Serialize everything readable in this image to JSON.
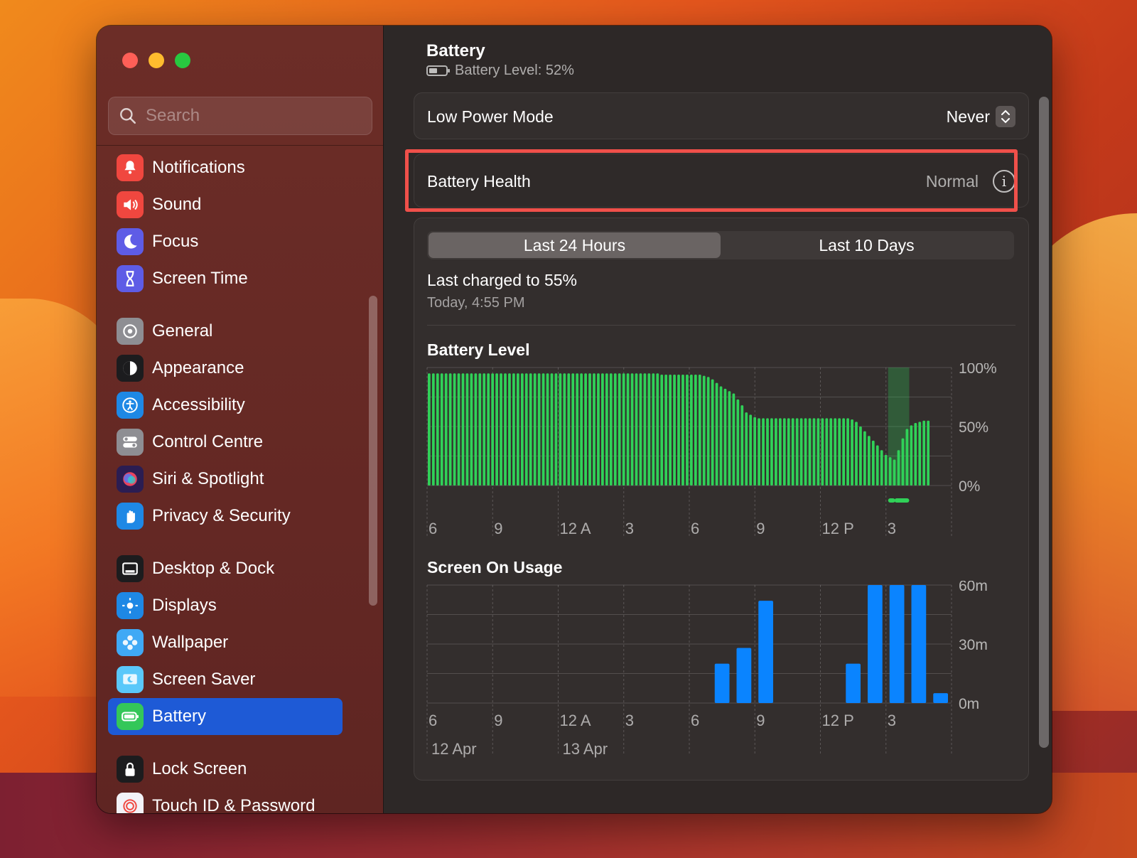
{
  "window": {
    "title": "Battery"
  },
  "search": {
    "placeholder": "Search"
  },
  "sidebar": {
    "groups": [
      [
        {
          "label": "Notifications",
          "icon": "bell-icon",
          "color": "#f0473f"
        },
        {
          "label": "Sound",
          "icon": "speaker-icon",
          "color": "#f0473f"
        },
        {
          "label": "Focus",
          "icon": "moon-icon",
          "color": "#5e5ce6"
        },
        {
          "label": "Screen Time",
          "icon": "hourglass-icon",
          "color": "#5e5ce6"
        }
      ],
      [
        {
          "label": "General",
          "icon": "gear-icon",
          "color": "#8e8e93"
        },
        {
          "label": "Appearance",
          "icon": "appearance-icon",
          "color": "#1c1c1e"
        },
        {
          "label": "Accessibility",
          "icon": "accessibility-icon",
          "color": "#1e88e5"
        },
        {
          "label": "Control Centre",
          "icon": "toggles-icon",
          "color": "#8e8e93"
        },
        {
          "label": "Siri & Spotlight",
          "icon": "siri-icon",
          "color": "#2b1d52"
        },
        {
          "label": "Privacy & Security",
          "icon": "hand-icon",
          "color": "#1e88e5"
        }
      ],
      [
        {
          "label": "Desktop & Dock",
          "icon": "dock-icon",
          "color": "#1c1c1e"
        },
        {
          "label": "Displays",
          "icon": "sun-icon",
          "color": "#1e88e5"
        },
        {
          "label": "Wallpaper",
          "icon": "flower-icon",
          "color": "#3fa9f5"
        },
        {
          "label": "Screen Saver",
          "icon": "screensaver-icon",
          "color": "#5ac8fa"
        },
        {
          "label": "Battery",
          "icon": "battery-icon",
          "color": "#34c759",
          "active": true
        }
      ],
      [
        {
          "label": "Lock Screen",
          "icon": "lock-icon",
          "color": "#1c1c1e"
        },
        {
          "label": "Touch ID & Password",
          "icon": "fingerprint-icon",
          "color": "#f2f2f7"
        }
      ]
    ]
  },
  "header": {
    "title": "Battery",
    "level_text": "Battery Level: 52%"
  },
  "low_power": {
    "label": "Low Power Mode",
    "value": "Never"
  },
  "health": {
    "label": "Battery Health",
    "value": "Normal"
  },
  "tabs": [
    {
      "label": "Last 24 Hours",
      "selected": true
    },
    {
      "label": "Last 10 Days",
      "selected": false
    }
  ],
  "last_charged": {
    "text": "Last charged to 55%",
    "time": "Today, 4:55 PM"
  },
  "colors": {
    "battery_green": "#30d158",
    "usage_blue": "#0a84ff",
    "highlight_red": "#f0504a"
  },
  "chart_data": [
    {
      "type": "bar",
      "title": "Battery Level",
      "ytick_labels": [
        "100%",
        "50%",
        "0%"
      ],
      "ylim": [
        0,
        100
      ],
      "xtick_labels": [
        "6",
        "9",
        "12 A",
        "3",
        "6",
        "9",
        "12 P",
        "3"
      ],
      "values": [
        95,
        95,
        95,
        95,
        95,
        95,
        95,
        95,
        95,
        95,
        95,
        95,
        95,
        95,
        95,
        95,
        95,
        95,
        95,
        95,
        95,
        95,
        95,
        95,
        95,
        95,
        95,
        95,
        95,
        95,
        95,
        95,
        95,
        95,
        95,
        95,
        95,
        95,
        95,
        95,
        95,
        95,
        95,
        95,
        95,
        95,
        95,
        95,
        95,
        95,
        95,
        95,
        95,
        95,
        95,
        94,
        94,
        94,
        94,
        94,
        94,
        94,
        94,
        94,
        94,
        93,
        92,
        90,
        87,
        84,
        82,
        80,
        78,
        73,
        68,
        62,
        60,
        58,
        57,
        57,
        57,
        57,
        57,
        57,
        57,
        57,
        57,
        57,
        57,
        57,
        57,
        57,
        57,
        57,
        57,
        57,
        57,
        57,
        57,
        57,
        56,
        54,
        50,
        46,
        42,
        38,
        34,
        30,
        26,
        24,
        22,
        30,
        40,
        48,
        51,
        53,
        54,
        55,
        55
      ],
      "charging_window": [
        109,
        114
      ]
    },
    {
      "type": "bar",
      "title": "Screen On Usage",
      "ytick_labels": [
        "60m",
        "30m",
        "0m"
      ],
      "ylim": [
        0,
        60
      ],
      "xtick_labels": [
        "6",
        "9",
        "12 A",
        "3",
        "6",
        "9",
        "12 P",
        "3"
      ],
      "date_labels": [
        "12 Apr",
        "13 Apr"
      ],
      "values": [
        0,
        0,
        0,
        0,
        0,
        0,
        0,
        0,
        0,
        0,
        0,
        0,
        0,
        20,
        28,
        52,
        0,
        0,
        0,
        20,
        60,
        60,
        60,
        5
      ]
    }
  ]
}
